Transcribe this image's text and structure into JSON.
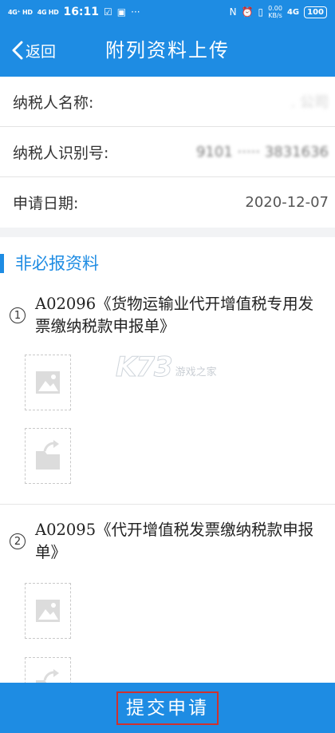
{
  "status_bar": {
    "signal_1": "4G⁺ HD",
    "signal_2": "4G HD",
    "time": "16:11",
    "icons": [
      "check-box-icon",
      "battery-saver-icon",
      "more-dots-icon",
      "nfc-icon",
      "alarm-icon",
      "vibrate-icon"
    ],
    "speed_value": "0.00",
    "speed_unit": "KB/s",
    "network": "4G",
    "battery": "100"
  },
  "nav": {
    "back_label": "返回",
    "title": "附列资料上传"
  },
  "info": {
    "rows": [
      {
        "label": "纳税人名称:",
        "value": ". 公司",
        "value_masked": true
      },
      {
        "label": "纳税人识别号:",
        "value": "9101 ····· 3831636",
        "value_masked": true
      },
      {
        "label": "申请日期:",
        "value": "2020-12-07",
        "value_masked": false
      }
    ]
  },
  "section": {
    "title": "非必报资料",
    "documents": [
      {
        "number": "1",
        "title": "A02096《货物运输业代开增值税专用发票缴纳税款申报单》"
      },
      {
        "number": "2",
        "title": "A02095《代开增值税发票缴纳税款申报单》"
      }
    ]
  },
  "watermark": {
    "logo": "K73",
    "text": "游戏之家"
  },
  "footer": {
    "submit_label": "提交申请"
  },
  "colors": {
    "primary": "#1e8ce3",
    "highlight_border": "#d0312d"
  }
}
